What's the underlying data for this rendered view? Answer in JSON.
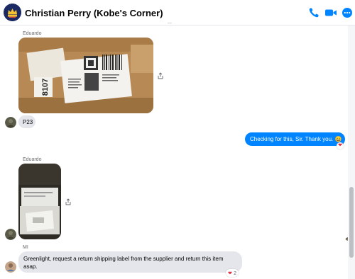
{
  "header": {
    "contact_name": "Christian Perry (Kobe's Corner)",
    "avatar_icon": "crown-logo-icon",
    "actions": [
      {
        "name": "call",
        "icon": "phone-icon"
      },
      {
        "name": "video",
        "icon": "video-camera-icon"
      },
      {
        "name": "more",
        "icon": "more-horizontal-icon"
      }
    ],
    "accent_color": "#0084ff"
  },
  "messages": [
    {
      "sender": "Eduardo",
      "type": "photo",
      "description_icon": "package-label-photo"
    },
    {
      "sender": "",
      "type": "text",
      "text": "P23"
    },
    {
      "sender": "me",
      "type": "text",
      "text": "Checking for this, Sir. Thank you. 😀",
      "reaction": "❤"
    },
    {
      "sender": "Eduardo",
      "type": "photo",
      "description_icon": "box-photo"
    },
    {
      "sender": "MI",
      "type": "text",
      "text_line1": "Greenlight, request a return shipping label from the supplier and return this item",
      "text_line2": "asap.",
      "reaction": "❤",
      "reaction_count": "2"
    }
  ]
}
